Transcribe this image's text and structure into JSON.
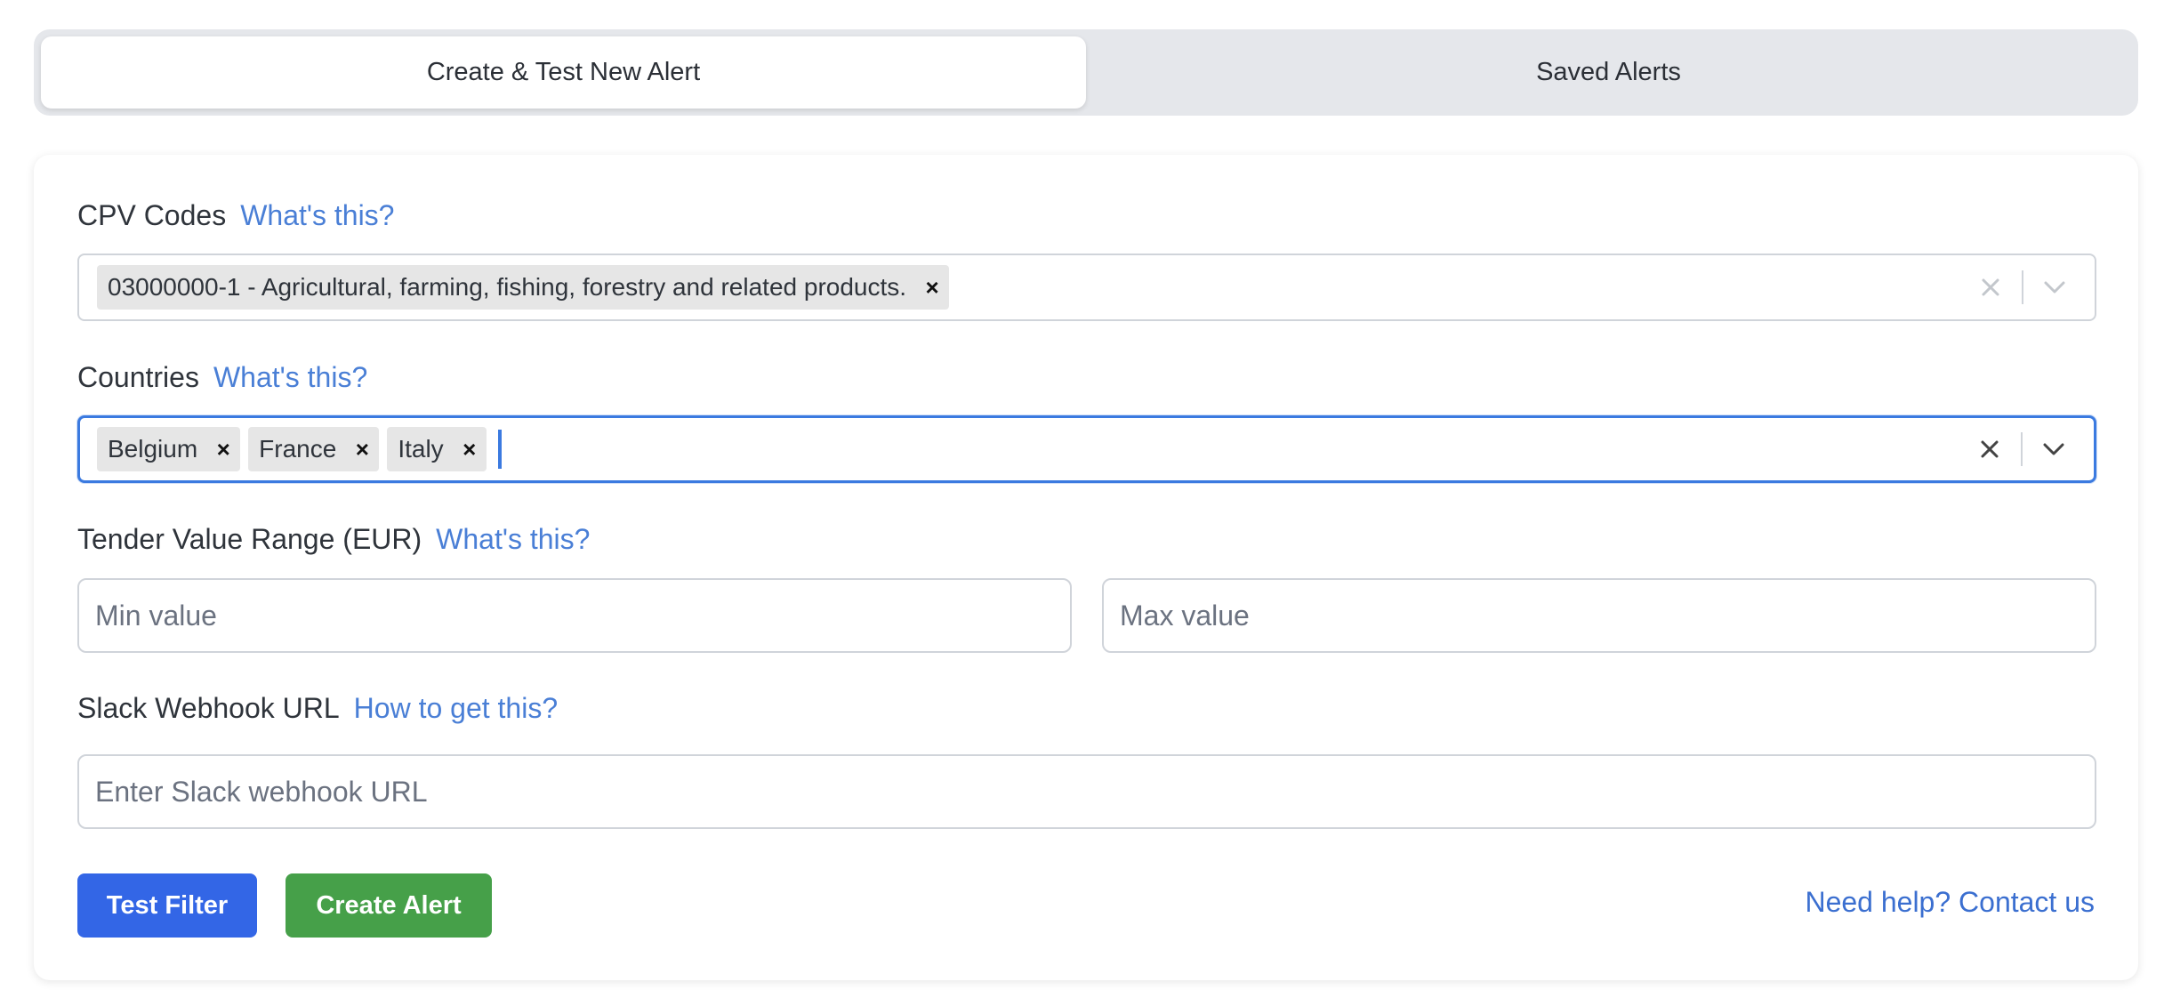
{
  "tabs": [
    {
      "label": "Create & Test New Alert",
      "active": true
    },
    {
      "label": "Saved Alerts",
      "active": false
    }
  ],
  "form": {
    "cpv": {
      "label": "CPV Codes",
      "help": "What's this?",
      "selected": [
        "03000000-1 - Agricultural, farming, fishing, forestry and related products."
      ]
    },
    "countries": {
      "label": "Countries",
      "help": "What's this?",
      "selected": [
        "Belgium",
        "France",
        "Italy"
      ]
    },
    "tender_value": {
      "label": "Tender Value Range (EUR)",
      "help": "What's this?",
      "min_placeholder": "Min value",
      "max_placeholder": "Max value"
    },
    "slack": {
      "label": "Slack Webhook URL",
      "help": "How to get this?",
      "placeholder": "Enter Slack webhook URL"
    }
  },
  "actions": {
    "test_label": "Test Filter",
    "create_label": "Create Alert",
    "contact_label": "Need help? Contact us"
  },
  "icons": {
    "chip_remove": "×",
    "clear": "clear-icon",
    "dropdown": "chevron-down-icon"
  },
  "colors": {
    "primary": "#3366e6",
    "success": "#46a049",
    "link": "#4a7fd6",
    "focus": "#3b7ae0"
  }
}
